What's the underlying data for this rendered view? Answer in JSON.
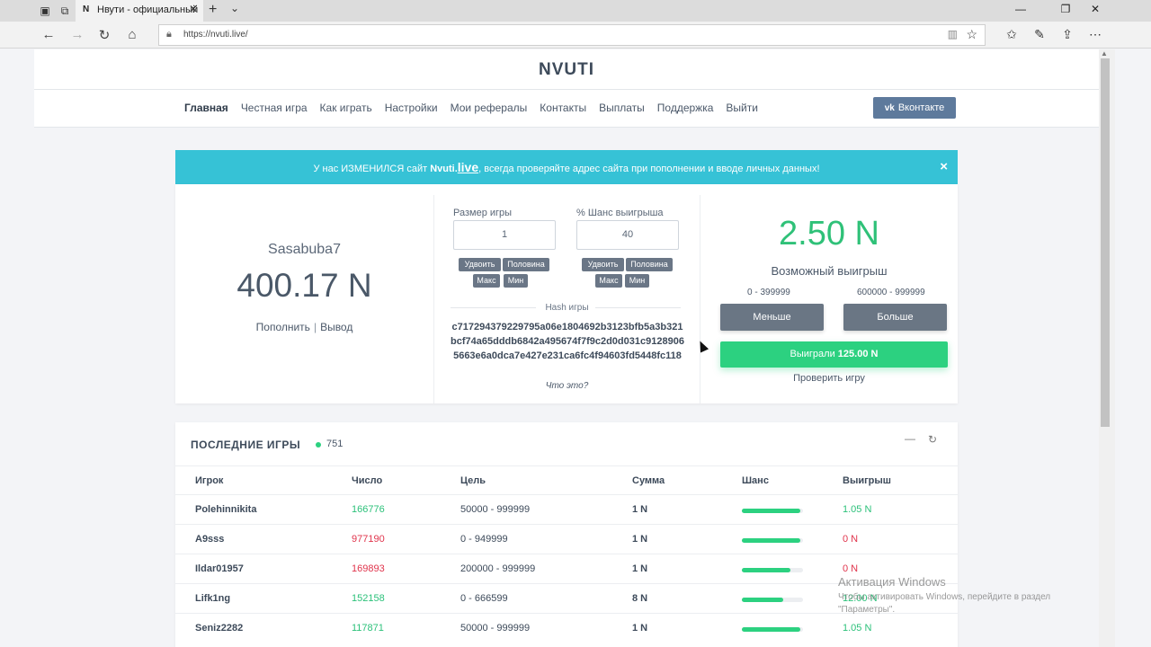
{
  "browser": {
    "tab_title": "Нвути - официальный",
    "tab_favicon": "N",
    "url": "https://nvuti.live/"
  },
  "site": {
    "logo": "NVUTI",
    "nav": [
      "Главная",
      "Честная игра",
      "Как играть",
      "Настройки",
      "Мои рефералы",
      "Контакты",
      "Выплаты",
      "Поддержка",
      "Выйти"
    ],
    "vk_button": "Вконтакте",
    "vk_logo": "vk"
  },
  "alert": {
    "prefix": "У нас ИЗМЕНИЛСЯ сайт",
    "brand": "Nvuti.",
    "brand_live": "live",
    "suffix": ", всегда проверяйте адрес сайта при пополнении и вводе личных данных!",
    "close": "×"
  },
  "account": {
    "username": "Sasabuba7",
    "balance": "400.17 N",
    "deposit": "Пополнить",
    "separator": "|",
    "withdraw": "Вывод"
  },
  "bet": {
    "size_label": "Размер игры",
    "size_value": "1",
    "chance_label": "% Шанс выигрыша",
    "chance_value": "40",
    "btn_double": "Удвоить",
    "btn_half": "Половина",
    "btn_max": "Макс",
    "btn_min": "Мин",
    "hash_label": "Hash игры",
    "hash_value": "c717294379229795a06e1804692b3123bfb5a3b321bcf74a65dddb6842a495674f7f9c2d0d031c91289065663e6a0dca7e427e231ca6fc4f94603fd5448fc118",
    "what_is_it": "Что это?"
  },
  "outcome": {
    "possible_win": "2.50 N",
    "possible_win_label": "Возможный выигрыш",
    "range_low": "0 - 399999",
    "range_high": "600000 - 999999",
    "btn_less": "Меньше",
    "btn_more": "Больше",
    "result_prefix": "Выиграли",
    "result_amount": "125.00 N",
    "verify": "Проверить игру"
  },
  "last_games": {
    "title": "ПОСЛЕДНИЕ ИГРЫ",
    "online": "751",
    "columns": [
      "Игрок",
      "Число",
      "Цель",
      "Сумма",
      "Шанс",
      "Выигрыш"
    ],
    "rows": [
      {
        "player": "Polehinnikita",
        "number": "166776",
        "win": true,
        "target": "50000 - 999999",
        "amount": "1 N",
        "chance": 95,
        "payout": "1.05 N"
      },
      {
        "player": "A9sss",
        "number": "977190",
        "win": false,
        "target": "0 - 949999",
        "amount": "1 N",
        "chance": 95,
        "payout": "0 N"
      },
      {
        "player": "Ildar01957",
        "number": "169893",
        "win": false,
        "target": "200000 - 999999",
        "amount": "1 N",
        "chance": 80,
        "payout": "0 N"
      },
      {
        "player": "Lifk1ng",
        "number": "152158",
        "win": true,
        "target": "0 - 666599",
        "amount": "8 N",
        "chance": 67,
        "payout": "12.00 N"
      },
      {
        "player": "Seniz2282",
        "number": "117871",
        "win": true,
        "target": "50000 - 999999",
        "amount": "1 N",
        "chance": 95,
        "payout": "1.05 N"
      }
    ],
    "colors": {
      "win": "#2cc17a",
      "lose": "#e0344c"
    }
  },
  "watermark": {
    "title": "Активация Windows",
    "text": "Чтобы активировать Windows, перейдите в раздел \"Параметры\"."
  }
}
